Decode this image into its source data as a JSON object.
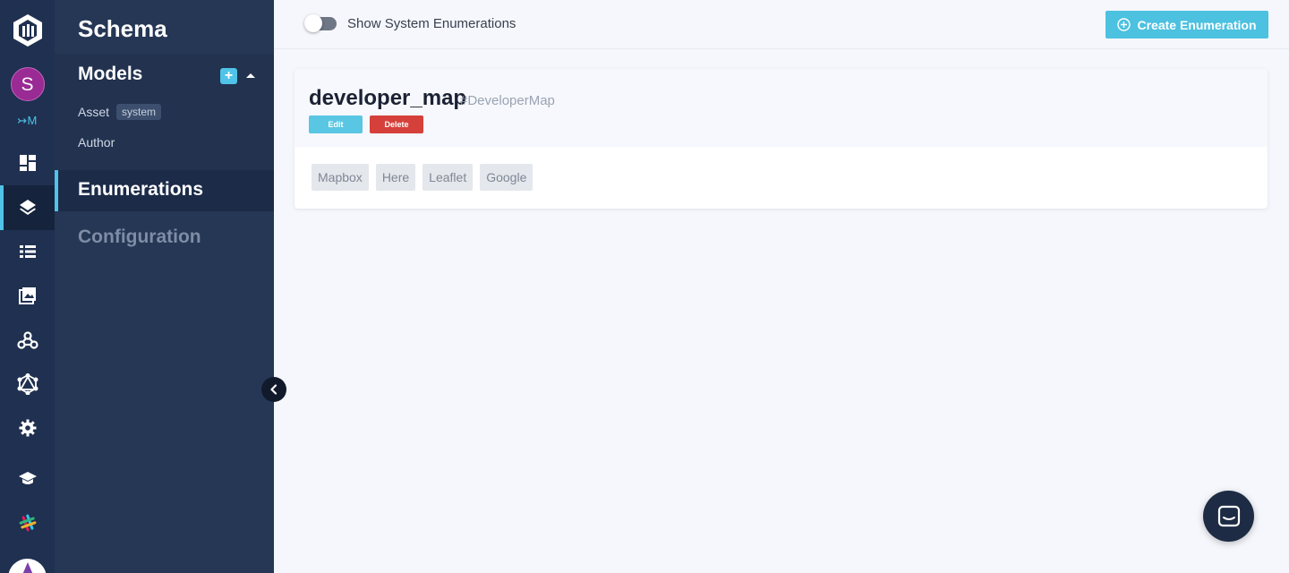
{
  "rail": {
    "avatar_initial": "S",
    "switch_label": "↣M",
    "accent_color": "#4fc3e8"
  },
  "sidebar": {
    "title": "Schema",
    "models_title": "Models",
    "add_symbol": "+",
    "models": [
      {
        "name": "Asset",
        "tag": "system"
      },
      {
        "name": "Author"
      }
    ],
    "nav": [
      {
        "label": "Enumerations",
        "active": true
      },
      {
        "label": "Configuration",
        "active": false
      }
    ]
  },
  "topbar": {
    "toggle_label": "Show System Enumerations",
    "toggle_on": false,
    "create_label": "Create Enumeration"
  },
  "enumeration": {
    "name": "developer_map",
    "api_id": "#DeveloperMap",
    "edit_label": "Edit",
    "delete_label": "Delete",
    "values": [
      "Mapbox",
      "Here",
      "Leaflet",
      "Google"
    ]
  },
  "colors": {
    "sidebar_bg": "#253755",
    "rail_bg": "#1f3050",
    "primary": "#4cc1e0",
    "danger": "#d6403a"
  }
}
